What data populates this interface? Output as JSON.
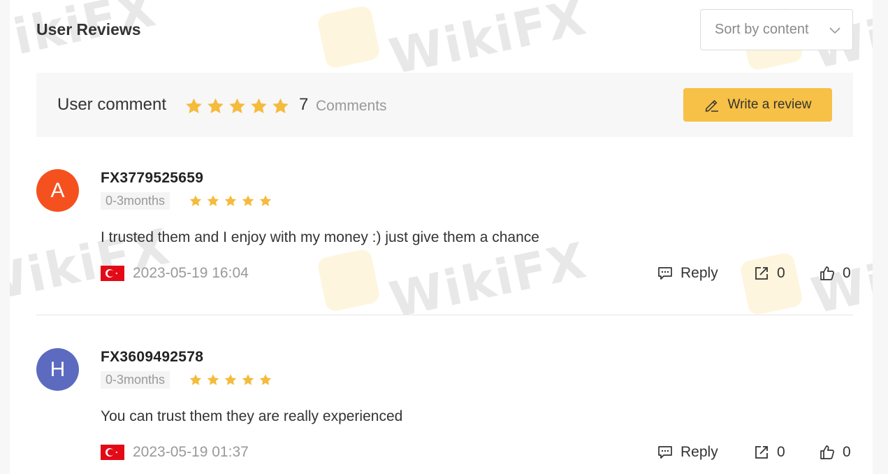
{
  "header": {
    "title": "User Reviews",
    "sort": {
      "selected": "Sort by content"
    }
  },
  "summary": {
    "title": "User comment",
    "rating_stars": 5,
    "count": "7",
    "comments_label": "Comments",
    "write_button": "Write a review"
  },
  "colors": {
    "star": "#f5bb3c",
    "button": "#f7c046",
    "avatar_a": "#f4511e",
    "avatar_h": "#5c6bc0"
  },
  "reviews": [
    {
      "avatar_letter": "A",
      "username": "FX3779525659",
      "duration": "0-3months",
      "rating_stars": 5,
      "comment": "I trusted them and I enjoy with my money :) just give them a chance",
      "country_flag_icon": "turkey-flag-icon",
      "date": "2023-05-19 16:04",
      "reply_label": "Reply",
      "share_count": "0",
      "like_count": "0"
    },
    {
      "avatar_letter": "H",
      "username": "FX3609492578",
      "duration": "0-3months",
      "rating_stars": 5,
      "comment": "You can trust them they are really experienced",
      "country_flag_icon": "turkey-flag-icon",
      "date": "2023-05-19 01:37",
      "reply_label": "Reply",
      "share_count": "0",
      "like_count": "0"
    }
  ]
}
